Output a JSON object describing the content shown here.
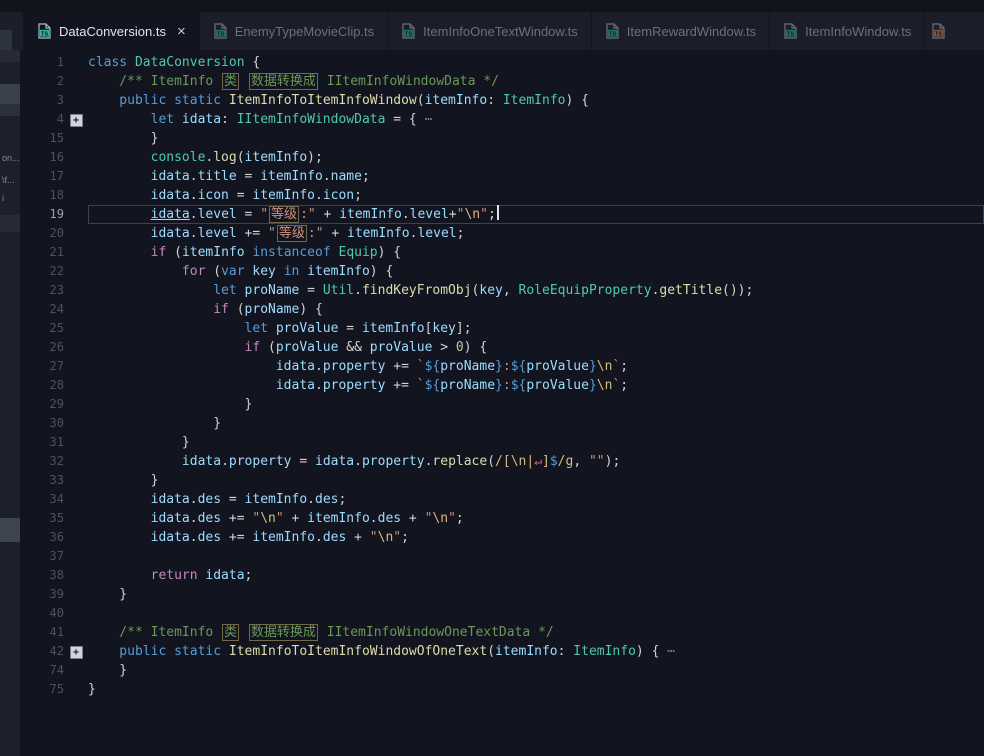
{
  "tab_strip": {
    "close_label": "×",
    "tabs": [
      {
        "label": "DataConversion.ts",
        "active": true,
        "has_close": true,
        "icon": "ts-file-icon",
        "icon_color": "#2fb3a3",
        "partial": false
      },
      {
        "label": "EnemyTypeMovieClip.ts",
        "active": false,
        "has_close": false,
        "icon": "ts-file-icon",
        "icon_color": "#2fb3a3",
        "partial": false
      },
      {
        "label": "ItemInfoOneTextWindow.ts",
        "active": false,
        "has_close": false,
        "icon": "ts-file-icon",
        "icon_color": "#2fb3a3",
        "partial": false
      },
      {
        "label": "ItemRewardWindow.ts",
        "active": false,
        "has_close": false,
        "icon": "ts-file-icon",
        "icon_color": "#2fb3a3",
        "partial": false
      },
      {
        "label": "ItemInfoWindow.ts",
        "active": false,
        "has_close": false,
        "icon": "ts-file-icon",
        "icon_color": "#2fb3a3",
        "partial": false
      },
      {
        "label": "",
        "active": false,
        "has_close": false,
        "icon": "ts-file-icon",
        "icon_color": "#cf8465",
        "partial": true
      }
    ]
  },
  "sidebar": {
    "fragments": [
      "on...",
      "\\f...",
      "i"
    ]
  },
  "editor": {
    "fold_glyph": "+",
    "palette": {
      "w": "#d4d4d4",
      "k": "#569cd6",
      "c": "#c586c0",
      "t": "#4ec9b0",
      "f": "#dcdcaa",
      "v": "#9cdcfe",
      "s": "#ce9178",
      "e": "#d7ba7d",
      "g": "#6a9955",
      "n": "#b5cea8",
      "d": "#7d8590",
      "r": "#d16969"
    },
    "ui_colors": {
      "editor_bg": "#121420",
      "tabbar_bg": "#1b1e28",
      "active_tab_bg": "#121420",
      "tab_text": "#69707e",
      "active_tab_text": "#e2e5ec",
      "line_number": "#4a5263",
      "active_line_number": "#9aa2b2",
      "current_line_border": "#3a4150",
      "sidebar_bg": "#1d202a",
      "accent": "#2fb3a3"
    },
    "lines": [
      {
        "n": "1",
        "tk": [
          [
            "k",
            "class"
          ],
          [
            "w",
            " "
          ],
          [
            "t",
            "DataConversion"
          ],
          [
            "w",
            " {"
          ]
        ]
      },
      {
        "n": "2",
        "tk": [
          [
            "g",
            "    /** ItemInfo "
          ],
          [
            "g",
            "类",
            "b"
          ],
          [
            "g",
            " "
          ],
          [
            "g",
            "数据转换成",
            "b"
          ],
          [
            "g",
            " IItemInfoWindowData */"
          ]
        ]
      },
      {
        "n": "3",
        "tk": [
          [
            "k",
            "    public"
          ],
          [
            "w",
            " "
          ],
          [
            "k",
            "static"
          ],
          [
            "w",
            " "
          ],
          [
            "f",
            "ItemInfoToItemInfoWindow"
          ],
          [
            "w",
            "("
          ],
          [
            "v",
            "itemInfo"
          ],
          [
            "w",
            ": "
          ],
          [
            "t",
            "ItemInfo"
          ],
          [
            "w",
            ") {"
          ]
        ]
      },
      {
        "n": "4",
        "fold": true,
        "tk": [
          [
            "k",
            "        let"
          ],
          [
            "w",
            " "
          ],
          [
            "v",
            "idata"
          ],
          [
            "w",
            ": "
          ],
          [
            "t",
            "IItemInfoWindowData"
          ],
          [
            "w",
            " = { "
          ],
          [
            "d",
            "⋯"
          ]
        ]
      },
      {
        "n": "15",
        "tk": [
          [
            "w",
            "        }"
          ]
        ]
      },
      {
        "n": "16",
        "tk": [
          [
            "t",
            "        console"
          ],
          [
            "w",
            "."
          ],
          [
            "f",
            "log"
          ],
          [
            "w",
            "("
          ],
          [
            "v",
            "itemInfo"
          ],
          [
            "w",
            ");"
          ]
        ]
      },
      {
        "n": "17",
        "tk": [
          [
            "v",
            "        idata"
          ],
          [
            "w",
            "."
          ],
          [
            "v",
            "title"
          ],
          [
            "w",
            " = "
          ],
          [
            "v",
            "itemInfo"
          ],
          [
            "w",
            "."
          ],
          [
            "v",
            "name"
          ],
          [
            "w",
            ";"
          ]
        ]
      },
      {
        "n": "18",
        "tk": [
          [
            "v",
            "        idata"
          ],
          [
            "w",
            "."
          ],
          [
            "v",
            "icon"
          ],
          [
            "w",
            " = "
          ],
          [
            "v",
            "itemInfo"
          ],
          [
            "w",
            "."
          ],
          [
            "v",
            "icon"
          ],
          [
            "w",
            ";"
          ]
        ]
      },
      {
        "n": "19",
        "active": true,
        "tk": [
          [
            "w",
            "        "
          ],
          [
            "v",
            "idata",
            "u"
          ],
          [
            "w",
            "."
          ],
          [
            "v",
            "level"
          ],
          [
            "w",
            " = "
          ],
          [
            "s",
            "\""
          ],
          [
            "s",
            "等级",
            "b"
          ],
          [
            "s",
            ":\""
          ],
          [
            "w",
            " + "
          ],
          [
            "v",
            "itemInfo"
          ],
          [
            "w",
            "."
          ],
          [
            "v",
            "level"
          ],
          [
            "w",
            "+"
          ],
          [
            "s",
            "\""
          ],
          [
            "e",
            "\\n"
          ],
          [
            "s",
            "\""
          ],
          [
            "w",
            ";",
            "cur"
          ]
        ]
      },
      {
        "n": "20",
        "tk": [
          [
            "v",
            "        idata"
          ],
          [
            "w",
            "."
          ],
          [
            "v",
            "level"
          ],
          [
            "w",
            " += "
          ],
          [
            "s",
            "\""
          ],
          [
            "s",
            "等级",
            "b"
          ],
          [
            "s",
            ":\""
          ],
          [
            "w",
            " + "
          ],
          [
            "v",
            "itemInfo"
          ],
          [
            "w",
            "."
          ],
          [
            "v",
            "level"
          ],
          [
            "w",
            ";"
          ]
        ]
      },
      {
        "n": "21",
        "tk": [
          [
            "c",
            "        if"
          ],
          [
            "w",
            " ("
          ],
          [
            "v",
            "itemInfo"
          ],
          [
            "w",
            " "
          ],
          [
            "k",
            "instanceof"
          ],
          [
            "w",
            " "
          ],
          [
            "t",
            "Equip"
          ],
          [
            "w",
            ") {"
          ]
        ]
      },
      {
        "n": "22",
        "tk": [
          [
            "c",
            "            for"
          ],
          [
            "w",
            " ("
          ],
          [
            "k",
            "var"
          ],
          [
            "w",
            " "
          ],
          [
            "v",
            "key"
          ],
          [
            "w",
            " "
          ],
          [
            "k",
            "in"
          ],
          [
            "w",
            " "
          ],
          [
            "v",
            "itemInfo"
          ],
          [
            "w",
            ") {"
          ]
        ]
      },
      {
        "n": "23",
        "tk": [
          [
            "k",
            "                let"
          ],
          [
            "w",
            " "
          ],
          [
            "v",
            "proName"
          ],
          [
            "w",
            " = "
          ],
          [
            "t",
            "Util"
          ],
          [
            "w",
            "."
          ],
          [
            "f",
            "findKeyFromObj"
          ],
          [
            "w",
            "("
          ],
          [
            "v",
            "key"
          ],
          [
            "w",
            ", "
          ],
          [
            "t",
            "RoleEquipProperty"
          ],
          [
            "w",
            "."
          ],
          [
            "f",
            "getTitle"
          ],
          [
            "w",
            "());"
          ]
        ]
      },
      {
        "n": "24",
        "tk": [
          [
            "c",
            "                if"
          ],
          [
            "w",
            " ("
          ],
          [
            "v",
            "proName"
          ],
          [
            "w",
            ") {"
          ]
        ]
      },
      {
        "n": "25",
        "tk": [
          [
            "k",
            "                    let"
          ],
          [
            "w",
            " "
          ],
          [
            "v",
            "proValue"
          ],
          [
            "w",
            " = "
          ],
          [
            "v",
            "itemInfo"
          ],
          [
            "w",
            "["
          ],
          [
            "v",
            "key"
          ],
          [
            "w",
            "];"
          ]
        ]
      },
      {
        "n": "26",
        "tk": [
          [
            "c",
            "                    if"
          ],
          [
            "w",
            " ("
          ],
          [
            "v",
            "proValue"
          ],
          [
            "w",
            " && "
          ],
          [
            "v",
            "proValue"
          ],
          [
            "w",
            " > "
          ],
          [
            "n",
            "0"
          ],
          [
            "w",
            ") {"
          ]
        ]
      },
      {
        "n": "27",
        "tk": [
          [
            "v",
            "                        idata"
          ],
          [
            "w",
            "."
          ],
          [
            "v",
            "property"
          ],
          [
            "w",
            " += "
          ],
          [
            "s",
            "`"
          ],
          [
            "k",
            "${"
          ],
          [
            "v",
            "proName"
          ],
          [
            "k",
            "}"
          ],
          [
            "s",
            ":"
          ],
          [
            "k",
            "${"
          ],
          [
            "v",
            "proValue"
          ],
          [
            "k",
            "}"
          ],
          [
            "e",
            "\\n"
          ],
          [
            "s",
            "`"
          ],
          [
            "w",
            ";"
          ]
        ]
      },
      {
        "n": "28",
        "tk": [
          [
            "v",
            "                        idata"
          ],
          [
            "w",
            "."
          ],
          [
            "v",
            "property"
          ],
          [
            "w",
            " += "
          ],
          [
            "s",
            "`"
          ],
          [
            "k",
            "${"
          ],
          [
            "v",
            "proName"
          ],
          [
            "k",
            "}"
          ],
          [
            "s",
            ":"
          ],
          [
            "k",
            "${"
          ],
          [
            "v",
            "proValue"
          ],
          [
            "k",
            "}"
          ],
          [
            "e",
            "\\n"
          ],
          [
            "s",
            "`"
          ],
          [
            "w",
            ";"
          ]
        ]
      },
      {
        "n": "29",
        "tk": [
          [
            "w",
            "                    }"
          ]
        ]
      },
      {
        "n": "30",
        "tk": [
          [
            "w",
            "                }"
          ]
        ]
      },
      {
        "n": "31",
        "tk": [
          [
            "w",
            "            }"
          ]
        ]
      },
      {
        "n": "32",
        "tk": [
          [
            "v",
            "            idata"
          ],
          [
            "w",
            "."
          ],
          [
            "v",
            "property"
          ],
          [
            "w",
            " = "
          ],
          [
            "v",
            "idata"
          ],
          [
            "w",
            "."
          ],
          [
            "v",
            "property"
          ],
          [
            "w",
            "."
          ],
          [
            "f",
            "replace"
          ],
          [
            "w",
            "("
          ],
          [
            "e",
            "/[\\n|"
          ],
          [
            "r",
            "↵"
          ],
          [
            "e",
            "]"
          ],
          [
            "k",
            "$"
          ],
          [
            "e",
            "/g"
          ],
          [
            "w",
            ", "
          ],
          [
            "s",
            "\"\""
          ],
          [
            "w",
            ");"
          ]
        ]
      },
      {
        "n": "33",
        "tk": [
          [
            "w",
            "        }"
          ]
        ]
      },
      {
        "n": "34",
        "tk": [
          [
            "v",
            "        idata"
          ],
          [
            "w",
            "."
          ],
          [
            "v",
            "des"
          ],
          [
            "w",
            " = "
          ],
          [
            "v",
            "itemInfo"
          ],
          [
            "w",
            "."
          ],
          [
            "v",
            "des"
          ],
          [
            "w",
            ";"
          ]
        ]
      },
      {
        "n": "35",
        "tk": [
          [
            "v",
            "        idata"
          ],
          [
            "w",
            "."
          ],
          [
            "v",
            "des"
          ],
          [
            "w",
            " += "
          ],
          [
            "s",
            "\""
          ],
          [
            "e",
            "\\n"
          ],
          [
            "s",
            "\""
          ],
          [
            "w",
            " + "
          ],
          [
            "v",
            "itemInfo"
          ],
          [
            "w",
            "."
          ],
          [
            "v",
            "des"
          ],
          [
            "w",
            " + "
          ],
          [
            "s",
            "\""
          ],
          [
            "e",
            "\\n"
          ],
          [
            "s",
            "\""
          ],
          [
            "w",
            ";"
          ]
        ]
      },
      {
        "n": "36",
        "tk": [
          [
            "v",
            "        idata"
          ],
          [
            "w",
            "."
          ],
          [
            "v",
            "des"
          ],
          [
            "w",
            " += "
          ],
          [
            "v",
            "itemInfo"
          ],
          [
            "w",
            "."
          ],
          [
            "v",
            "des"
          ],
          [
            "w",
            " + "
          ],
          [
            "s",
            "\""
          ],
          [
            "e",
            "\\n"
          ],
          [
            "s",
            "\""
          ],
          [
            "w",
            ";"
          ]
        ]
      },
      {
        "n": "37",
        "tk": []
      },
      {
        "n": "38",
        "tk": [
          [
            "c",
            "        return"
          ],
          [
            "w",
            " "
          ],
          [
            "v",
            "idata"
          ],
          [
            "w",
            ";"
          ]
        ]
      },
      {
        "n": "39",
        "tk": [
          [
            "w",
            "    }"
          ]
        ]
      },
      {
        "n": "40",
        "tk": []
      },
      {
        "n": "41",
        "tk": [
          [
            "g",
            "    /** ItemInfo "
          ],
          [
            "g",
            "类",
            "b"
          ],
          [
            "g",
            " "
          ],
          [
            "g",
            "数据转换成",
            "b"
          ],
          [
            "g",
            " IItemInfoWindowOneTextData */"
          ]
        ]
      },
      {
        "n": "42",
        "fold": true,
        "tk": [
          [
            "k",
            "    public"
          ],
          [
            "w",
            " "
          ],
          [
            "k",
            "static"
          ],
          [
            "w",
            " "
          ],
          [
            "f",
            "ItemInfoToItemInfoWindowOfOneText"
          ],
          [
            "w",
            "("
          ],
          [
            "v",
            "itemInfo"
          ],
          [
            "w",
            ": "
          ],
          [
            "t",
            "ItemInfo"
          ],
          [
            "w",
            ") { "
          ],
          [
            "d",
            "⋯"
          ]
        ]
      },
      {
        "n": "74",
        "tk": [
          [
            "w",
            "    }"
          ]
        ]
      },
      {
        "n": "75",
        "tk": [
          [
            "w",
            "}"
          ]
        ]
      }
    ]
  }
}
